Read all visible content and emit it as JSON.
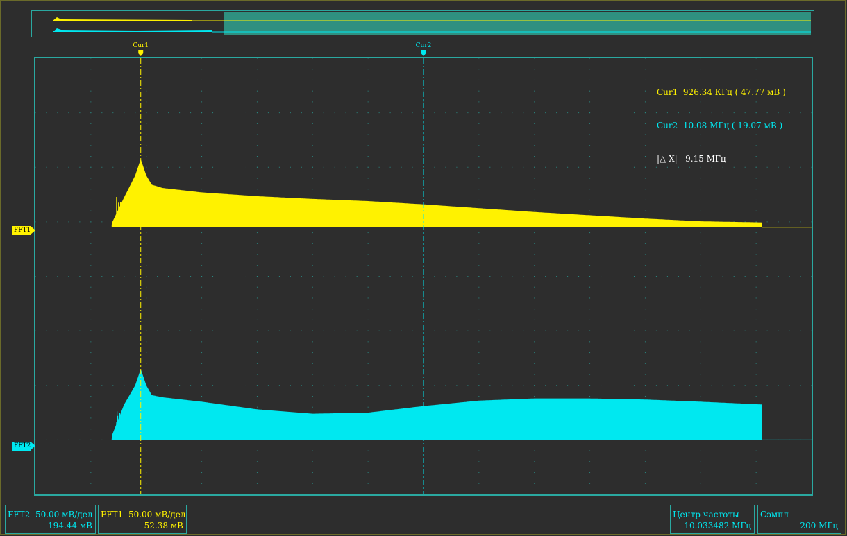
{
  "colors": {
    "fft1": "#fff200",
    "fft2": "#00e8f0",
    "frame": "#2aa8a0",
    "grid": "#2aa8a0",
    "background": "#2d2d2d",
    "info_text": "#00e8f0"
  },
  "cursors": {
    "cur1": {
      "tag": "Cur1",
      "color": "#fff200"
    },
    "cur2": {
      "tag": "Cur2",
      "color": "#00e8f0"
    }
  },
  "readout": {
    "cur1": {
      "label": "Cur1",
      "value": "926.34 КГц ( 47.77 мВ )"
    },
    "cur2": {
      "label": "Cur2",
      "value": "10.08 МГц ( 19.07 мВ )"
    },
    "delta": {
      "label": "|△ X|",
      "value": "9.15 МГц"
    }
  },
  "channels": {
    "fft1": {
      "label": "FFT1"
    },
    "fft2": {
      "label": "FFT2"
    }
  },
  "info": {
    "fft2": {
      "label": "FFT2",
      "scale": "50.00 мВ/дел",
      "offset": "-194.44 мВ"
    },
    "fft1": {
      "label": "FFT1",
      "scale": "50.00 мВ/дел",
      "offset": "52.38 мВ"
    },
    "center": {
      "label": "Центр частоты",
      "value": "10.033482 МГц"
    },
    "sample": {
      "label": "Сэмпл",
      "value": "200 МГц"
    }
  },
  "chart_data": {
    "type": "area",
    "title": "",
    "xlabel": "",
    "ylabel": "",
    "grid": true,
    "divisions": {
      "x": 14,
      "y": 8
    },
    "xlim_div": [
      0,
      14
    ],
    "ylim_div": [
      0,
      8
    ],
    "cursor_positions_div": {
      "cur1": 1.9,
      "cur2": 7.0
    },
    "series": [
      {
        "name": "FFT1",
        "baseline_div": 3.1,
        "end_div": 13.1,
        "envelope": [
          [
            1.38,
            0.08
          ],
          [
            1.6,
            0.55
          ],
          [
            1.8,
            0.95
          ],
          [
            1.9,
            1.25
          ],
          [
            2.0,
            0.95
          ],
          [
            2.1,
            0.78
          ],
          [
            2.3,
            0.72
          ],
          [
            3.0,
            0.64
          ],
          [
            4.0,
            0.57
          ],
          [
            5.0,
            0.52
          ],
          [
            6.0,
            0.48
          ],
          [
            7.0,
            0.42
          ],
          [
            8.0,
            0.35
          ],
          [
            9.0,
            0.28
          ],
          [
            10.0,
            0.22
          ],
          [
            11.0,
            0.16
          ],
          [
            12.0,
            0.11
          ],
          [
            13.1,
            0.09
          ]
        ]
      },
      {
        "name": "FFT2",
        "baseline_div": 7.0,
        "end_div": 13.1,
        "envelope": [
          [
            1.38,
            0.08
          ],
          [
            1.6,
            0.65
          ],
          [
            1.8,
            1.0
          ],
          [
            1.9,
            1.3
          ],
          [
            2.0,
            1.0
          ],
          [
            2.1,
            0.82
          ],
          [
            2.3,
            0.78
          ],
          [
            3.0,
            0.7
          ],
          [
            4.0,
            0.56
          ],
          [
            5.0,
            0.48
          ],
          [
            6.0,
            0.5
          ],
          [
            7.0,
            0.62
          ],
          [
            8.0,
            0.72
          ],
          [
            9.0,
            0.76
          ],
          [
            10.0,
            0.76
          ],
          [
            11.0,
            0.74
          ],
          [
            12.0,
            0.7
          ],
          [
            13.1,
            0.65
          ]
        ]
      }
    ]
  }
}
